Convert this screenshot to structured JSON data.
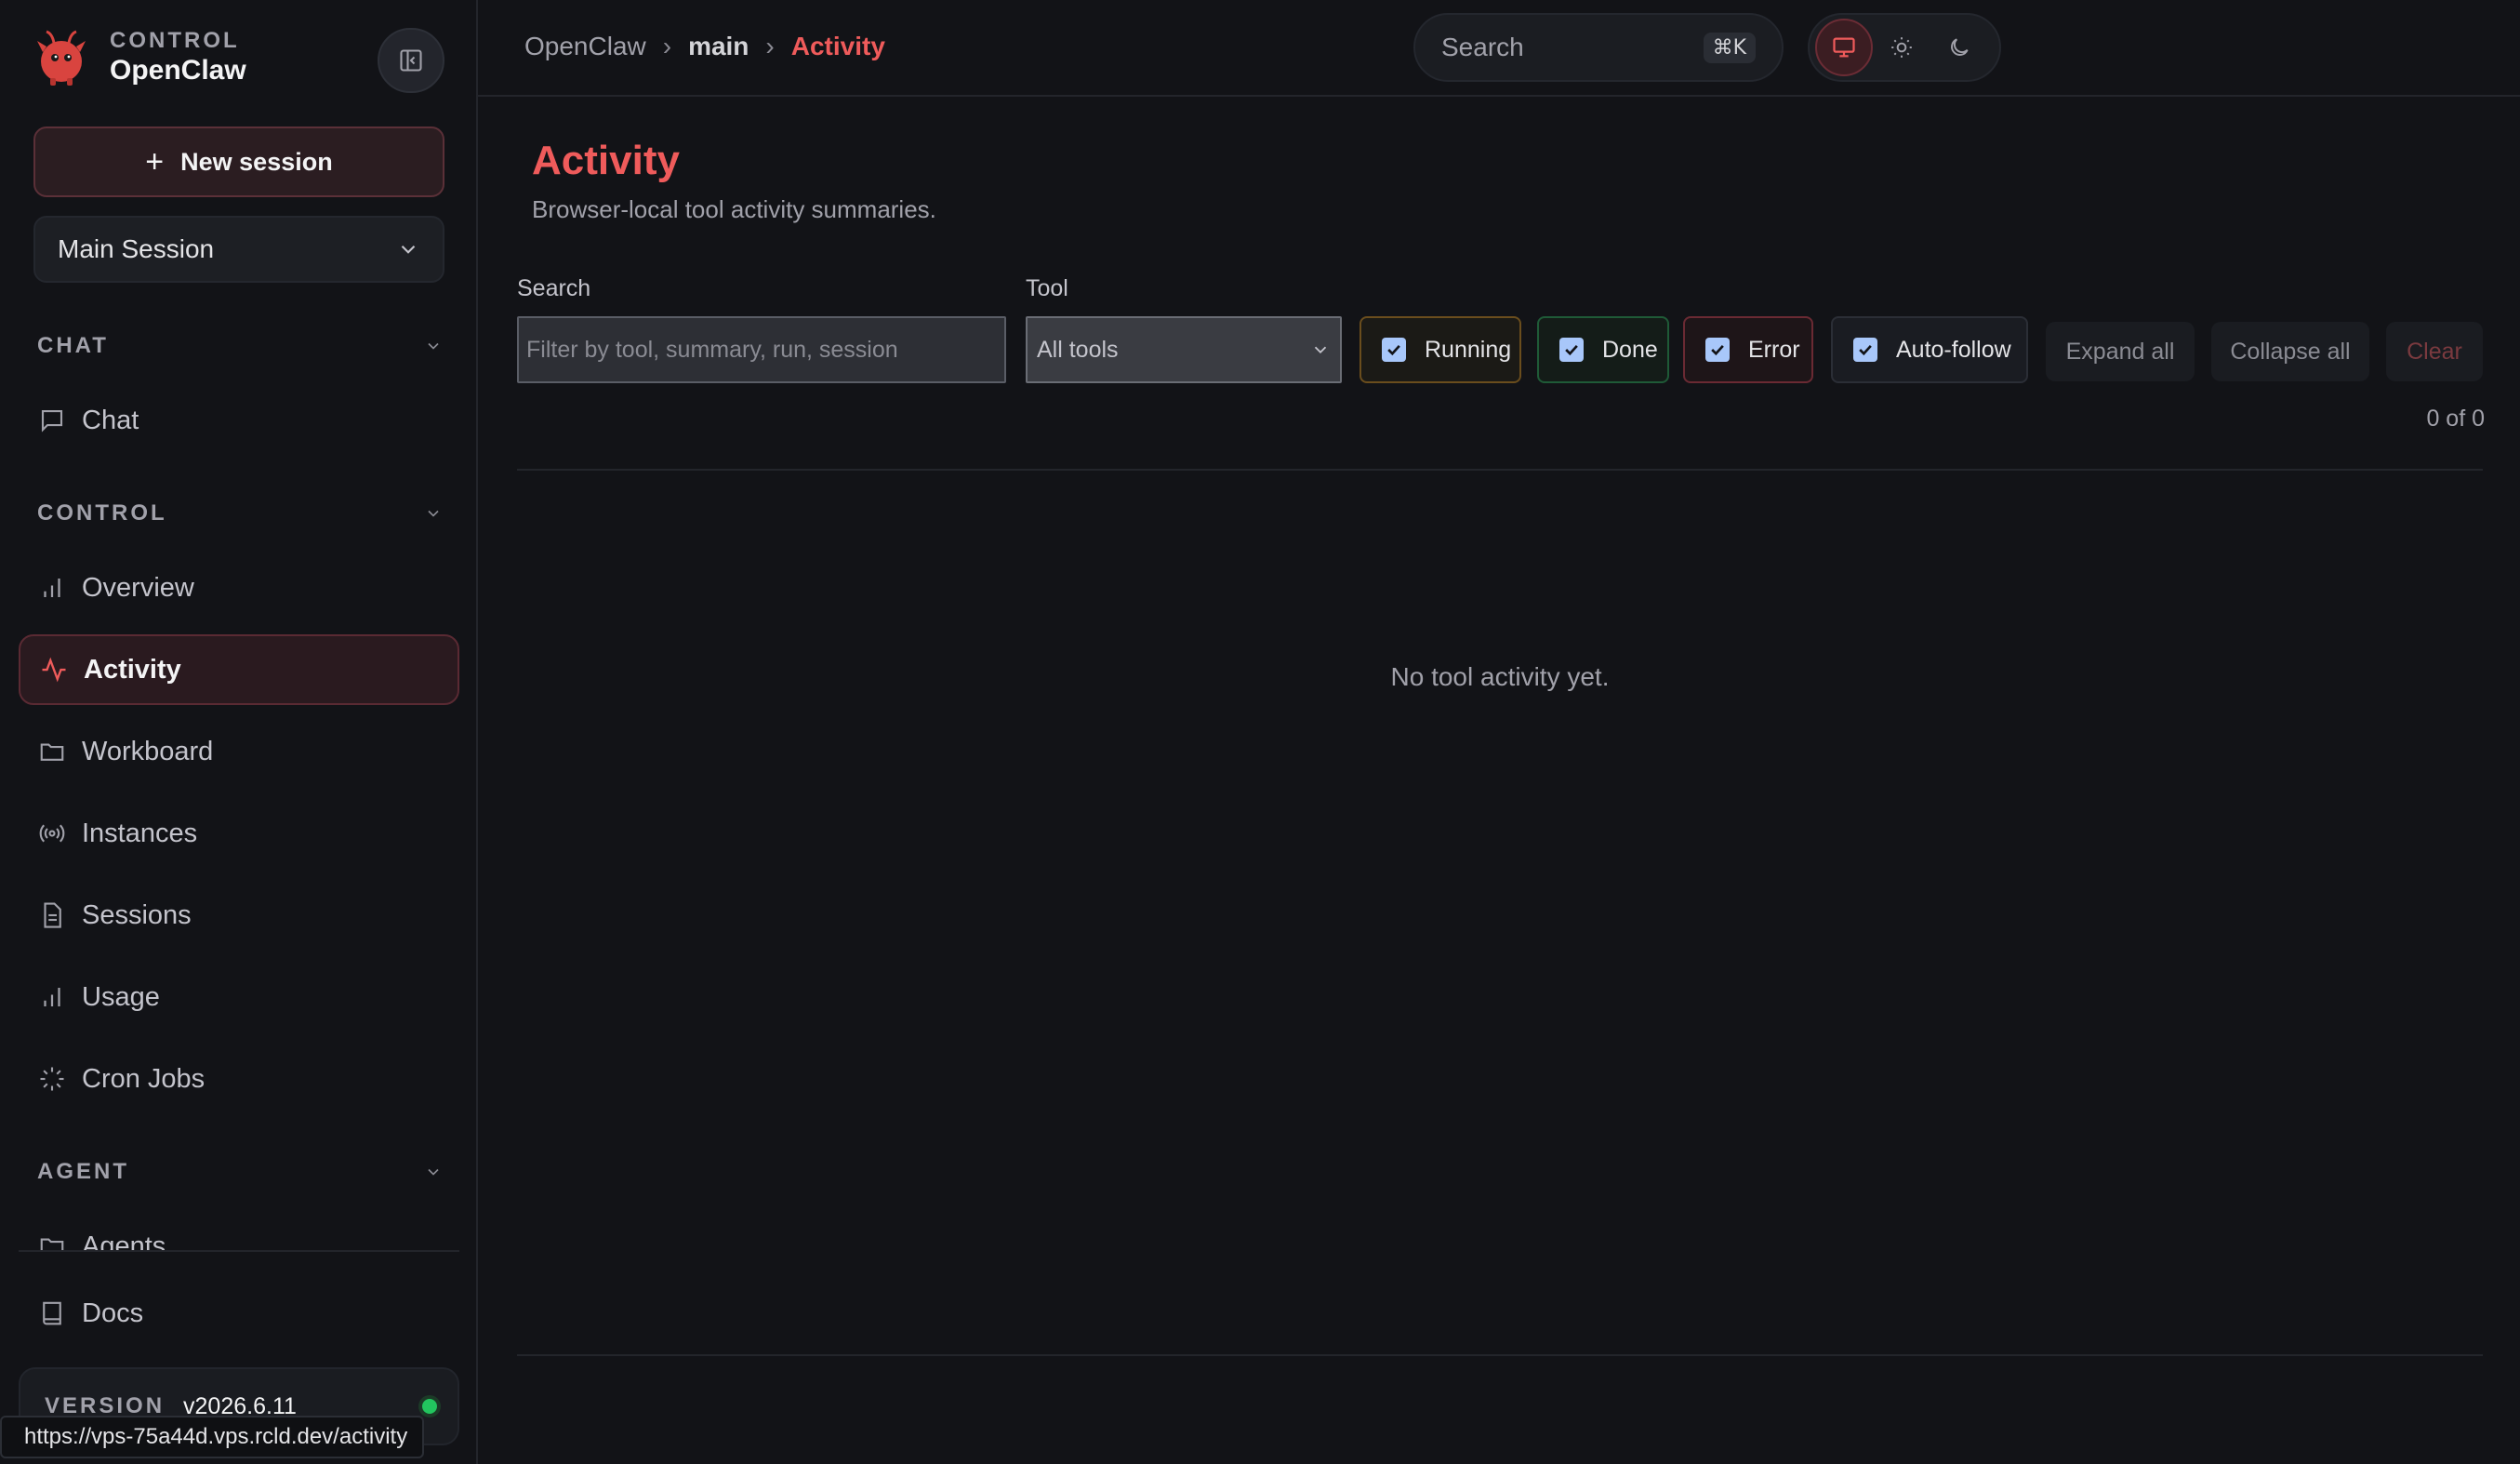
{
  "brand": {
    "sub": "CONTROL",
    "name": "OpenClaw"
  },
  "sidebar": {
    "new_session": "New session",
    "session_select": "Main Session",
    "sections": [
      {
        "title": "CHAT",
        "items": [
          {
            "label": "Chat",
            "icon": "message-icon"
          }
        ]
      },
      {
        "title": "CONTROL",
        "items": [
          {
            "label": "Overview",
            "icon": "bar-chart-icon"
          },
          {
            "label": "Activity",
            "icon": "activity-icon",
            "active": true
          },
          {
            "label": "Workboard",
            "icon": "folder-icon"
          },
          {
            "label": "Instances",
            "icon": "radio-icon"
          },
          {
            "label": "Sessions",
            "icon": "document-icon"
          },
          {
            "label": "Usage",
            "icon": "bar-chart-icon"
          },
          {
            "label": "Cron Jobs",
            "icon": "loader-icon"
          }
        ]
      },
      {
        "title": "AGENT",
        "items": [
          {
            "label": "Agents",
            "icon": "folder-icon"
          }
        ]
      }
    ],
    "docs": "Docs",
    "version_label": "VERSION",
    "version_value": "v2026.6.11",
    "status_color": "#22c55e"
  },
  "url_tooltip": "https://vps-75a44d.vps.rcld.dev/activity",
  "topbar": {
    "breadcrumb": [
      "OpenClaw",
      "main",
      "Activity"
    ],
    "search_placeholder": "Search",
    "shortcut": "⌘K",
    "theme_modes": [
      "monitor-icon",
      "sun-icon",
      "moon-icon"
    ],
    "active_theme": "system"
  },
  "main": {
    "title": "Activity",
    "subtitle": "Browser-local tool activity summaries.",
    "search_label": "Search",
    "search_placeholder": "Filter by tool, summary, run, session",
    "tool_label": "Tool",
    "tool_value": "All tools",
    "filters": [
      {
        "label": "Running",
        "checked": true
      },
      {
        "label": "Done",
        "checked": true
      },
      {
        "label": "Error",
        "checked": true
      },
      {
        "label": "Auto-follow",
        "checked": true
      }
    ],
    "expand_all": "Expand all",
    "collapse_all": "Collapse all",
    "clear": "Clear",
    "count": "0 of 0",
    "empty_message": "No tool activity yet."
  },
  "colors": {
    "accent": "#ef5b5b",
    "running": "#6a4d1d",
    "done": "#1f5a37",
    "error": "#6a2a33"
  }
}
